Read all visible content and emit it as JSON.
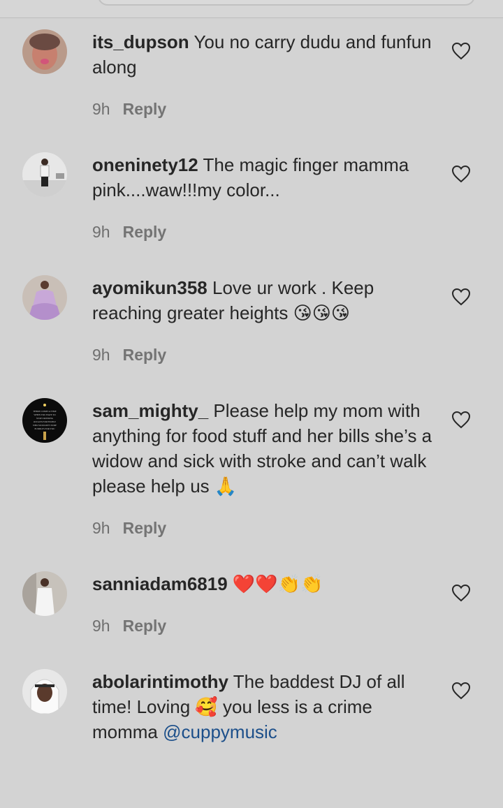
{
  "comments": [
    {
      "username": "its_dupson",
      "text": "You no carry dudu and funfun along",
      "time": "9h",
      "reply": "Reply",
      "avatar": "woman-pink-avatar"
    },
    {
      "username": "oneninety12",
      "text": "The magic finger mamma pink....waw!!!my color...",
      "time": "9h",
      "reply": "Reply",
      "avatar": "man-standing-avatar"
    },
    {
      "username": "ayomikun358",
      "text": "Love ur work . Keep reaching greater heights 😘😘😘",
      "time": "9h",
      "reply": "Reply",
      "avatar": "woman-purple-dress-avatar"
    },
    {
      "username": "sam_mighty_",
      "text": "Please help my mom with anything for food stuff and her bills she’s a widow and sick with stroke and can’t walk please help us 🙏",
      "time": "9h",
      "reply": "Reply",
      "avatar": "dark-quote-avatar",
      "avatar_text": "THERE COMES A TIME WHEN YOU HAVE TO STOP CROSSING OCEANS FOR PEOPLE WHO WOULDN'T JUMP PUDDLES FOR YOU"
    },
    {
      "username": "sanniadam6819",
      "text": "❤️❤️👏👏",
      "time": "9h",
      "reply": "Reply",
      "avatar": "man-white-attire-avatar"
    },
    {
      "username": "abolarintimothy",
      "text_before": "The baddest DJ of all time! Loving 🥰 you less is a crime momma",
      "mention": "@cuppymusic",
      "avatar": "man-headscarf-avatar"
    }
  ],
  "colors": {
    "background": "#d3d3d3",
    "text": "#262626",
    "meta": "#6f6f6f",
    "mention": "#1c4f8a"
  },
  "icons": {
    "like": "heart-outline-icon"
  }
}
